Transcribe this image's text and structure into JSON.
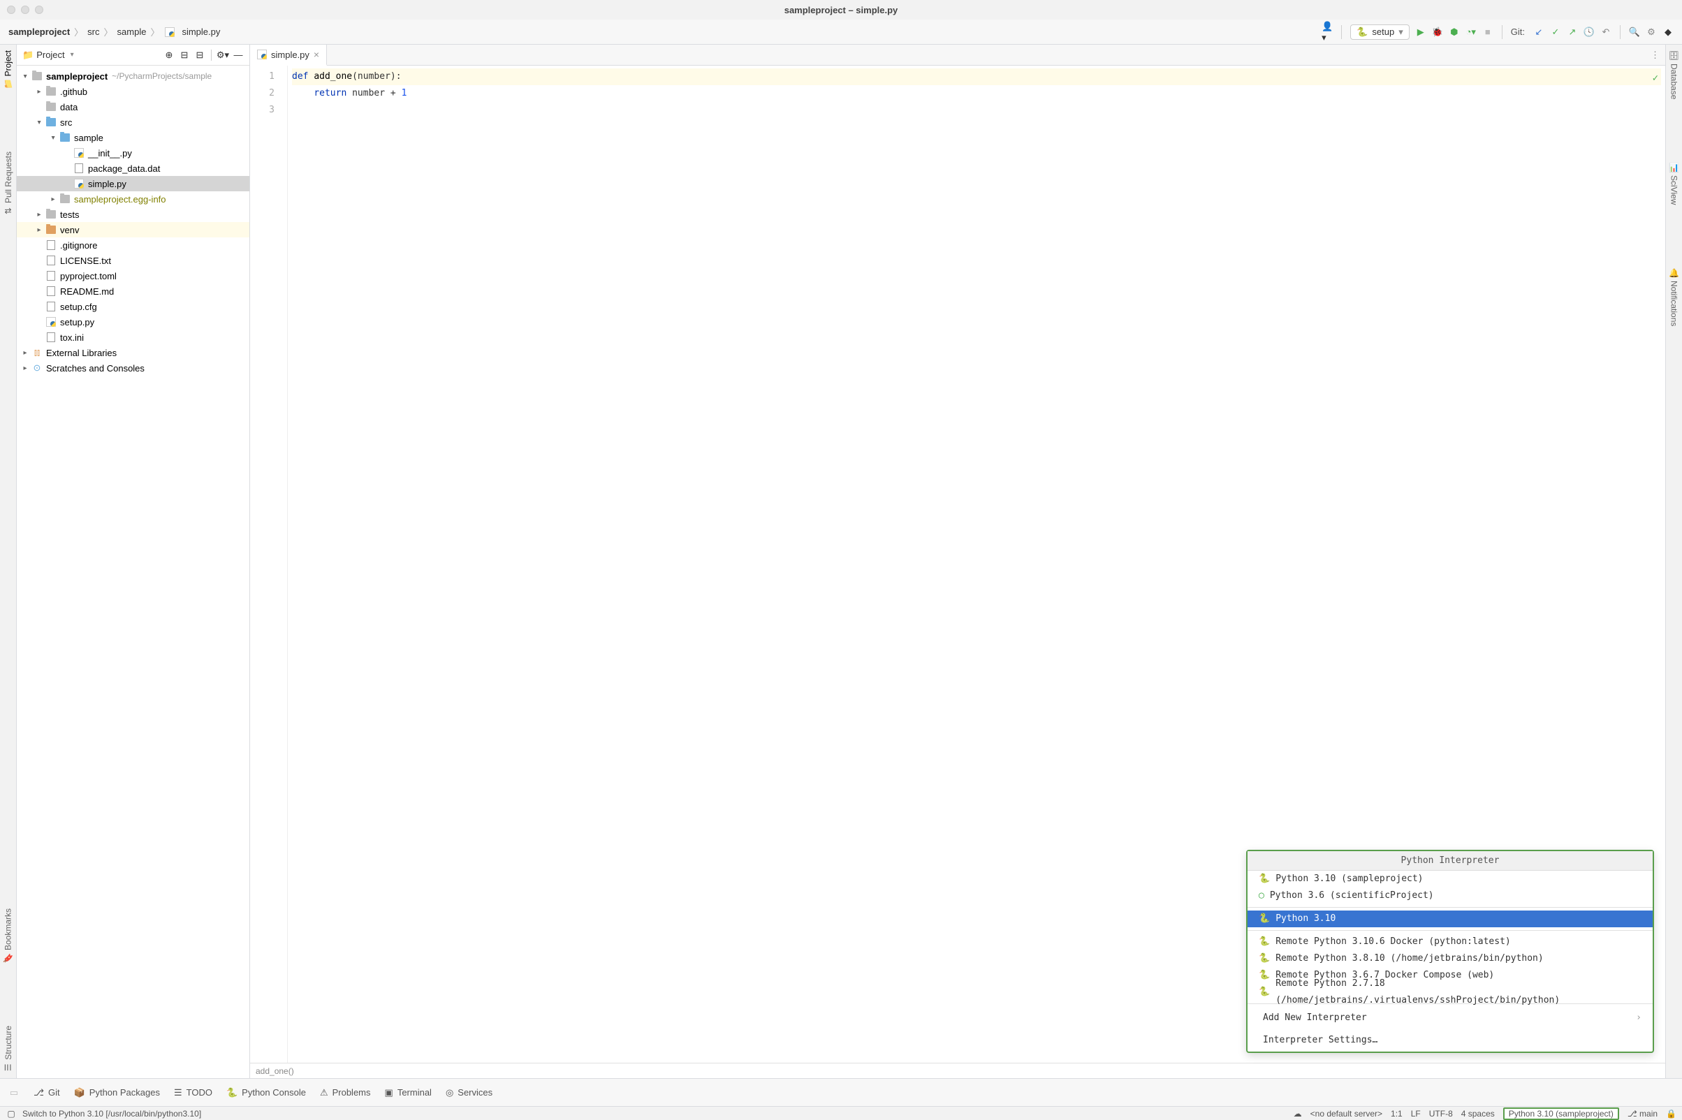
{
  "titlebar": {
    "title": "sampleproject – simple.py"
  },
  "breadcrumbs": [
    "sampleproject",
    "src",
    "sample",
    "simple.py"
  ],
  "toolbar": {
    "run_config": "setup",
    "git_label": "Git:"
  },
  "left_strip": [
    "Project",
    "Pull Requests",
    "Bookmarks",
    "Structure"
  ],
  "right_strip": [
    "Database",
    "SciView",
    "Notifications"
  ],
  "project_panel": {
    "title": "Project",
    "root": {
      "name": "sampleproject",
      "path": "~/PycharmProjects/sample"
    },
    "tree": [
      {
        "indent": 1,
        "arrow": "closed",
        "icon": "folder",
        "label": ".github"
      },
      {
        "indent": 1,
        "arrow": "none",
        "icon": "folder",
        "label": "data"
      },
      {
        "indent": 1,
        "arrow": "open",
        "icon": "folder-blue",
        "label": "src"
      },
      {
        "indent": 2,
        "arrow": "open",
        "icon": "folder-blue",
        "label": "sample"
      },
      {
        "indent": 3,
        "arrow": "none",
        "icon": "pyfile",
        "label": "__init__.py"
      },
      {
        "indent": 3,
        "arrow": "none",
        "icon": "file",
        "label": "package_data.dat"
      },
      {
        "indent": 3,
        "arrow": "none",
        "icon": "pyfile",
        "label": "simple.py",
        "selected": true
      },
      {
        "indent": 2,
        "arrow": "closed",
        "icon": "folder",
        "label": "sampleproject.egg-info",
        "olive": true
      },
      {
        "indent": 1,
        "arrow": "closed",
        "icon": "folder",
        "label": "tests"
      },
      {
        "indent": 1,
        "arrow": "closed",
        "icon": "folder-orange",
        "label": "venv",
        "highlighted": true
      },
      {
        "indent": 1,
        "arrow": "none",
        "icon": "file",
        "label": ".gitignore"
      },
      {
        "indent": 1,
        "arrow": "none",
        "icon": "file",
        "label": "LICENSE.txt"
      },
      {
        "indent": 1,
        "arrow": "none",
        "icon": "file",
        "label": "pyproject.toml"
      },
      {
        "indent": 1,
        "arrow": "none",
        "icon": "file",
        "label": "README.md"
      },
      {
        "indent": 1,
        "arrow": "none",
        "icon": "file",
        "label": "setup.cfg"
      },
      {
        "indent": 1,
        "arrow": "none",
        "icon": "pyfile",
        "label": "setup.py"
      },
      {
        "indent": 1,
        "arrow": "none",
        "icon": "file",
        "label": "tox.ini"
      },
      {
        "indent": 0,
        "arrow": "closed",
        "icon": "lib",
        "label": "External Libraries"
      },
      {
        "indent": 0,
        "arrow": "closed",
        "icon": "scratch",
        "label": "Scratches and Consoles"
      }
    ]
  },
  "tabs": [
    {
      "name": "simple.py",
      "active": true
    }
  ],
  "editor": {
    "lines": [
      {
        "num": "1",
        "html": "<span class='kw'>def</span> <span class='fn'>add_one</span>(number):",
        "hl": true
      },
      {
        "num": "2",
        "html": "    <span class='kw'>return</span> number + <span class='num'>1</span>"
      },
      {
        "num": "3",
        "html": ""
      }
    ],
    "breadcrumb": "add_one()"
  },
  "interpreter_popup": {
    "title": "Python Interpreter",
    "groups": [
      [
        {
          "label": "Python 3.10 (sampleproject)",
          "icon": "python"
        },
        {
          "label": "Python 3.6 (scientificProject)",
          "icon": "conda"
        }
      ],
      [
        {
          "label": "Python 3.10",
          "selected": true,
          "icon": "python"
        }
      ],
      [
        {
          "label": "Remote Python 3.10.6 Docker (python:latest)",
          "icon": "python"
        },
        {
          "label": "Remote Python 3.8.10 (/home/jetbrains/bin/python)",
          "icon": "python"
        },
        {
          "label": "Remote Python 3.6.7 Docker Compose (web)",
          "icon": "python"
        },
        {
          "label": "Remote Python 2.7.18 (/home/jetbrains/.virtualenvs/sshProject/bin/python)",
          "icon": "python"
        }
      ]
    ],
    "actions": [
      {
        "label": "Add New Interpreter",
        "chevron": true
      },
      {
        "label": "Interpreter Settings…"
      }
    ]
  },
  "bottom_panel": [
    "Git",
    "Python Packages",
    "TODO",
    "Python Console",
    "Problems",
    "Terminal",
    "Services"
  ],
  "statusbar": {
    "left": "Switch to Python 3.10 [/usr/local/bin/python3.10]",
    "server": "<no default server>",
    "pos": "1:1",
    "sep": "LF",
    "enc": "UTF-8",
    "indent": "4 spaces",
    "interpreter": "Python 3.10 (sampleproject)",
    "branch": "main"
  }
}
